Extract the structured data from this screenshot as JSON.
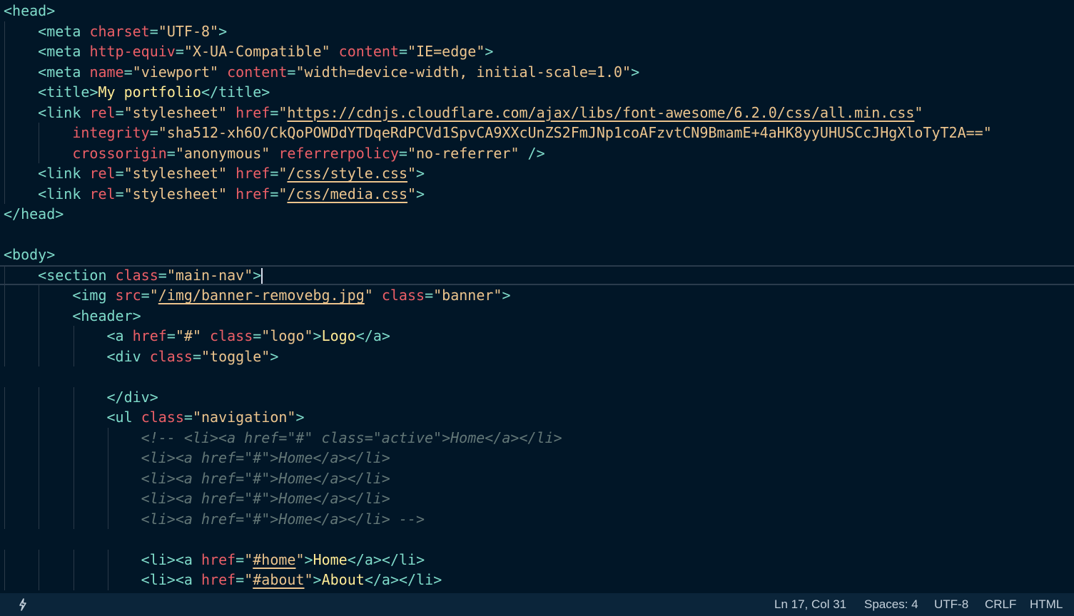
{
  "editor": {
    "lines": [
      [
        {
          "t": "<",
          "c": "tag"
        },
        {
          "t": "head",
          "c": "tag"
        },
        {
          "t": ">",
          "c": "tag"
        }
      ],
      [
        {
          "t": "    "
        },
        {
          "t": "<",
          "c": "tag"
        },
        {
          "t": "meta",
          "c": "tag"
        },
        {
          "t": " "
        },
        {
          "t": "charset",
          "c": "attr"
        },
        {
          "t": "=",
          "c": "eq"
        },
        {
          "t": "\"UTF-8\"",
          "c": "str"
        },
        {
          "t": ">",
          "c": "tag"
        }
      ],
      [
        {
          "t": "    "
        },
        {
          "t": "<",
          "c": "tag"
        },
        {
          "t": "meta",
          "c": "tag"
        },
        {
          "t": " "
        },
        {
          "t": "http-equiv",
          "c": "attr"
        },
        {
          "t": "=",
          "c": "eq"
        },
        {
          "t": "\"X-UA-Compatible\"",
          "c": "str"
        },
        {
          "t": " "
        },
        {
          "t": "content",
          "c": "attr"
        },
        {
          "t": "=",
          "c": "eq"
        },
        {
          "t": "\"IE=edge\"",
          "c": "str"
        },
        {
          "t": ">",
          "c": "tag"
        }
      ],
      [
        {
          "t": "    "
        },
        {
          "t": "<",
          "c": "tag"
        },
        {
          "t": "meta",
          "c": "tag"
        },
        {
          "t": " "
        },
        {
          "t": "name",
          "c": "attr"
        },
        {
          "t": "=",
          "c": "eq"
        },
        {
          "t": "\"viewport\"",
          "c": "str"
        },
        {
          "t": " "
        },
        {
          "t": "content",
          "c": "attr"
        },
        {
          "t": "=",
          "c": "eq"
        },
        {
          "t": "\"width=device-width, initial-scale=1.0\"",
          "c": "str"
        },
        {
          "t": ">",
          "c": "tag"
        }
      ],
      [
        {
          "t": "    "
        },
        {
          "t": "<",
          "c": "tag"
        },
        {
          "t": "title",
          "c": "tag"
        },
        {
          "t": ">",
          "c": "tag"
        },
        {
          "t": "My portfolio",
          "c": "txt"
        },
        {
          "t": "</",
          "c": "tag"
        },
        {
          "t": "title",
          "c": "tag"
        },
        {
          "t": ">",
          "c": "tag"
        }
      ],
      [
        {
          "t": "    "
        },
        {
          "t": "<",
          "c": "tag"
        },
        {
          "t": "link",
          "c": "tag"
        },
        {
          "t": " "
        },
        {
          "t": "rel",
          "c": "attr"
        },
        {
          "t": "=",
          "c": "eq"
        },
        {
          "t": "\"stylesheet\"",
          "c": "str"
        },
        {
          "t": " "
        },
        {
          "t": "href",
          "c": "attr"
        },
        {
          "t": "=",
          "c": "eq"
        },
        {
          "t": "\"",
          "c": "str"
        },
        {
          "t": "https://cdnjs.cloudflare.com/ajax/libs/font-awesome/6.2.0/css/all.min.css",
          "c": "url"
        },
        {
          "t": "\"",
          "c": "str"
        }
      ],
      [
        {
          "t": "        "
        },
        {
          "t": "integrity",
          "c": "attr"
        },
        {
          "t": "=",
          "c": "eq"
        },
        {
          "t": "\"sha512-xh6O/CkQoPOWDdYTDqeRdPCVd1SpvCA9XXcUnZS2FmJNp1coAFzvtCN9BmamE+4aHK8yyUHUSCcJHgXloTyT2A==\"",
          "c": "str"
        }
      ],
      [
        {
          "t": "        "
        },
        {
          "t": "crossorigin",
          "c": "attr"
        },
        {
          "t": "=",
          "c": "eq"
        },
        {
          "t": "\"anonymous\"",
          "c": "str"
        },
        {
          "t": " "
        },
        {
          "t": "referrerpolicy",
          "c": "attr"
        },
        {
          "t": "=",
          "c": "eq"
        },
        {
          "t": "\"no-referrer\"",
          "c": "str"
        },
        {
          "t": " "
        },
        {
          "t": "/>",
          "c": "tag"
        }
      ],
      [
        {
          "t": "    "
        },
        {
          "t": "<",
          "c": "tag"
        },
        {
          "t": "link",
          "c": "tag"
        },
        {
          "t": " "
        },
        {
          "t": "rel",
          "c": "attr"
        },
        {
          "t": "=",
          "c": "eq"
        },
        {
          "t": "\"stylesheet\"",
          "c": "str"
        },
        {
          "t": " "
        },
        {
          "t": "href",
          "c": "attr"
        },
        {
          "t": "=",
          "c": "eq"
        },
        {
          "t": "\"",
          "c": "str"
        },
        {
          "t": "/css/style.css",
          "c": "url"
        },
        {
          "t": "\"",
          "c": "str"
        },
        {
          "t": ">",
          "c": "tag"
        }
      ],
      [
        {
          "t": "    "
        },
        {
          "t": "<",
          "c": "tag"
        },
        {
          "t": "link",
          "c": "tag"
        },
        {
          "t": " "
        },
        {
          "t": "rel",
          "c": "attr"
        },
        {
          "t": "=",
          "c": "eq"
        },
        {
          "t": "\"stylesheet\"",
          "c": "str"
        },
        {
          "t": " "
        },
        {
          "t": "href",
          "c": "attr"
        },
        {
          "t": "=",
          "c": "eq"
        },
        {
          "t": "\"",
          "c": "str"
        },
        {
          "t": "/css/media.css",
          "c": "url"
        },
        {
          "t": "\"",
          "c": "str"
        },
        {
          "t": ">",
          "c": "tag"
        }
      ],
      [
        {
          "t": "</",
          "c": "tag"
        },
        {
          "t": "head",
          "c": "tag"
        },
        {
          "t": ">",
          "c": "tag"
        }
      ],
      [],
      [
        {
          "t": "<",
          "c": "tag"
        },
        {
          "t": "body",
          "c": "tag"
        },
        {
          "t": ">",
          "c": "tag"
        }
      ],
      [
        {
          "t": "    "
        },
        {
          "t": "<",
          "c": "tag"
        },
        {
          "t": "section",
          "c": "tag"
        },
        {
          "t": " "
        },
        {
          "t": "class",
          "c": "attr"
        },
        {
          "t": "=",
          "c": "eq"
        },
        {
          "t": "\"main-nav\"",
          "c": "str"
        },
        {
          "t": ">",
          "c": "tag"
        }
      ],
      [
        {
          "t": "        "
        },
        {
          "t": "<",
          "c": "tag"
        },
        {
          "t": "img",
          "c": "tag"
        },
        {
          "t": " "
        },
        {
          "t": "src",
          "c": "attr"
        },
        {
          "t": "=",
          "c": "eq"
        },
        {
          "t": "\"",
          "c": "str"
        },
        {
          "t": "/img/banner-removebg.jpg",
          "c": "url"
        },
        {
          "t": "\"",
          "c": "str"
        },
        {
          "t": " "
        },
        {
          "t": "class",
          "c": "attr"
        },
        {
          "t": "=",
          "c": "eq"
        },
        {
          "t": "\"banner\"",
          "c": "str"
        },
        {
          "t": ">",
          "c": "tag"
        }
      ],
      [
        {
          "t": "        "
        },
        {
          "t": "<",
          "c": "tag"
        },
        {
          "t": "header",
          "c": "tag"
        },
        {
          "t": ">",
          "c": "tag"
        }
      ],
      [
        {
          "t": "            "
        },
        {
          "t": "<",
          "c": "tag"
        },
        {
          "t": "a",
          "c": "tag"
        },
        {
          "t": " "
        },
        {
          "t": "href",
          "c": "attr"
        },
        {
          "t": "=",
          "c": "eq"
        },
        {
          "t": "\"#\"",
          "c": "str"
        },
        {
          "t": " "
        },
        {
          "t": "class",
          "c": "attr"
        },
        {
          "t": "=",
          "c": "eq"
        },
        {
          "t": "\"logo\"",
          "c": "str"
        },
        {
          "t": ">",
          "c": "tag"
        },
        {
          "t": "Logo",
          "c": "txt"
        },
        {
          "t": "</",
          "c": "tag"
        },
        {
          "t": "a",
          "c": "tag"
        },
        {
          "t": ">",
          "c": "tag"
        }
      ],
      [
        {
          "t": "            "
        },
        {
          "t": "<",
          "c": "tag"
        },
        {
          "t": "div",
          "c": "tag"
        },
        {
          "t": " "
        },
        {
          "t": "class",
          "c": "attr"
        },
        {
          "t": "=",
          "c": "eq"
        },
        {
          "t": "\"toggle\"",
          "c": "str"
        },
        {
          "t": ">",
          "c": "tag"
        }
      ],
      [],
      [
        {
          "t": "            "
        },
        {
          "t": "</",
          "c": "tag"
        },
        {
          "t": "div",
          "c": "tag"
        },
        {
          "t": ">",
          "c": "tag"
        }
      ],
      [
        {
          "t": "            "
        },
        {
          "t": "<",
          "c": "tag"
        },
        {
          "t": "ul",
          "c": "tag"
        },
        {
          "t": " "
        },
        {
          "t": "class",
          "c": "attr"
        },
        {
          "t": "=",
          "c": "eq"
        },
        {
          "t": "\"navigation\"",
          "c": "str"
        },
        {
          "t": ">",
          "c": "tag"
        }
      ],
      [
        {
          "t": "                "
        },
        {
          "t": "<!-- <li><a href=\"#\" class=\"active\">Home</a></li>",
          "c": "cmt"
        }
      ],
      [
        {
          "t": "                "
        },
        {
          "t": "<li><a href=\"#\">Home</a></li>",
          "c": "cmt"
        }
      ],
      [
        {
          "t": "                "
        },
        {
          "t": "<li><a href=\"#\">Home</a></li>",
          "c": "cmt"
        }
      ],
      [
        {
          "t": "                "
        },
        {
          "t": "<li><a href=\"#\">Home</a></li>",
          "c": "cmt"
        }
      ],
      [
        {
          "t": "                "
        },
        {
          "t": "<li><a href=\"#\">Home</a></li> -->",
          "c": "cmt"
        }
      ],
      [],
      [
        {
          "t": "                "
        },
        {
          "t": "<",
          "c": "tag"
        },
        {
          "t": "li",
          "c": "tag"
        },
        {
          "t": ">",
          "c": "tag"
        },
        {
          "t": "<",
          "c": "tag"
        },
        {
          "t": "a",
          "c": "tag"
        },
        {
          "t": " "
        },
        {
          "t": "href",
          "c": "attr"
        },
        {
          "t": "=",
          "c": "eq"
        },
        {
          "t": "\"",
          "c": "str"
        },
        {
          "t": "#home",
          "c": "url"
        },
        {
          "t": "\"",
          "c": "str"
        },
        {
          "t": ">",
          "c": "tag"
        },
        {
          "t": "Home",
          "c": "txt"
        },
        {
          "t": "</",
          "c": "tag"
        },
        {
          "t": "a",
          "c": "tag"
        },
        {
          "t": ">",
          "c": "tag"
        },
        {
          "t": "</",
          "c": "tag"
        },
        {
          "t": "li",
          "c": "tag"
        },
        {
          "t": ">",
          "c": "tag"
        }
      ],
      [
        {
          "t": "                "
        },
        {
          "t": "<",
          "c": "tag"
        },
        {
          "t": "li",
          "c": "tag"
        },
        {
          "t": ">",
          "c": "tag"
        },
        {
          "t": "<",
          "c": "tag"
        },
        {
          "t": "a",
          "c": "tag"
        },
        {
          "t": " "
        },
        {
          "t": "href",
          "c": "attr"
        },
        {
          "t": "=",
          "c": "eq"
        },
        {
          "t": "\"",
          "c": "str"
        },
        {
          "t": "#about",
          "c": "url"
        },
        {
          "t": "\"",
          "c": "str"
        },
        {
          "t": ">",
          "c": "tag"
        },
        {
          "t": "About",
          "c": "txt"
        },
        {
          "t": "</",
          "c": "tag"
        },
        {
          "t": "a",
          "c": "tag"
        },
        {
          "t": ">",
          "c": "tag"
        },
        {
          "t": "</",
          "c": "tag"
        },
        {
          "t": "li",
          "c": "tag"
        },
        {
          "t": ">",
          "c": "tag"
        }
      ]
    ],
    "current_line": 13
  },
  "statusbar": {
    "icon": "feedback-icon",
    "position": "Ln 17, Col 31",
    "indentation": "Spaces: 4",
    "encoding": "UTF-8",
    "line_ending": "CRLF",
    "language": "HTML"
  },
  "colors": {
    "background": "#011627",
    "statusbar": "#0b253a",
    "tag": "#7fdbca",
    "attribute": "#ec5f67",
    "string": "#ecc48d",
    "text": "#ffeb95",
    "comment": "#637777"
  }
}
